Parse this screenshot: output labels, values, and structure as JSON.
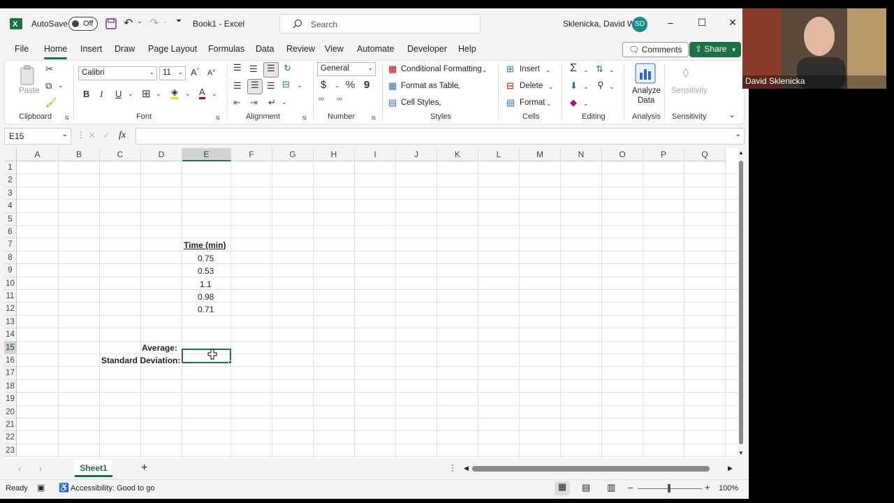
{
  "titlebar": {
    "autosave_label": "AutoSave",
    "autosave_state": "Off",
    "doc_title": "Book1  -  Excel",
    "search_placeholder": "Search",
    "user_name": "Sklenicka, David W",
    "user_initials": "SD"
  },
  "menu": {
    "tabs": [
      "File",
      "Home",
      "Insert",
      "Draw",
      "Page Layout",
      "Formulas",
      "Data",
      "Review",
      "View",
      "Automate",
      "Developer",
      "Help"
    ],
    "comments": "Comments",
    "share": "Share"
  },
  "ribbon": {
    "clipboard": {
      "label": "Clipboard",
      "paste": "Paste"
    },
    "font": {
      "label": "Font",
      "name": "Calibri",
      "size": "11"
    },
    "alignment": {
      "label": "Alignment"
    },
    "number": {
      "label": "Number",
      "format": "General"
    },
    "styles": {
      "label": "Styles",
      "conditional": "Conditional Formatting",
      "format_table": "Format as Table",
      "cell_styles": "Cell Styles"
    },
    "cells": {
      "label": "Cells",
      "insert": "Insert",
      "delete": "Delete",
      "format": "Format"
    },
    "editing": {
      "label": "Editing"
    },
    "analysis": {
      "label": "Analysis",
      "analyze1": "Analyze",
      "analyze2": "Data"
    },
    "sensitivity": {
      "label": "Sensitivity",
      "button": "Sensitivity"
    }
  },
  "formula_bar": {
    "name_box": "E15",
    "fx": "fx",
    "value": ""
  },
  "grid": {
    "columns": [
      "A",
      "B",
      "C",
      "D",
      "E",
      "F",
      "G",
      "H",
      "I",
      "J",
      "K",
      "L",
      "M",
      "N",
      "O",
      "P",
      "Q"
    ],
    "rows": [
      "1",
      "2",
      "3",
      "4",
      "5",
      "6",
      "7",
      "8",
      "9",
      "10",
      "11",
      "12",
      "13",
      "14",
      "15",
      "16",
      "17",
      "18",
      "19",
      "20",
      "21",
      "22",
      "23"
    ],
    "header": "Time (min)",
    "values": [
      "0.75",
      "0.53",
      "1.1",
      "0.98",
      "0.71"
    ],
    "average_label": "Average:",
    "stdev_label": "Standard Deviation:"
  },
  "sheet_tab": "Sheet1",
  "status": {
    "ready": "Ready",
    "accessibility": "Accessibility: Good to go",
    "zoom": "100%"
  },
  "webcam": {
    "name": "David Sklenicka"
  },
  "colors": {
    "excel_green": "#1e7145",
    "avatar": "#1b8a8a"
  }
}
